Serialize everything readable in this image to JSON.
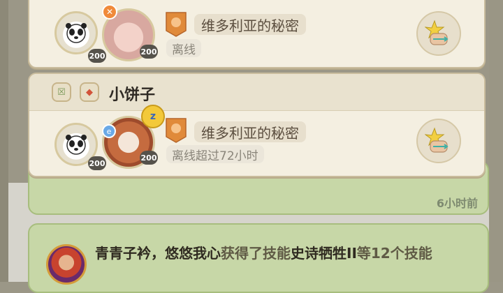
{
  "friends": [
    {
      "name": "",
      "avatars": [
        {
          "kind": "panda",
          "level": "200"
        },
        {
          "kind": "pink",
          "level": "200"
        }
      ],
      "zone": "维多利亚的秘密",
      "status": "离线"
    },
    {
      "name": "小饼子",
      "avatars": [
        {
          "kind": "panda",
          "level": "200"
        },
        {
          "kind": "girl",
          "level": "200"
        }
      ],
      "zone": "维多利亚的秘密",
      "status": "离线超过72小时"
    }
  ],
  "feed": {
    "prev_time": "6小时前",
    "current": {
      "player": "青青子衿，悠悠我心",
      "verb": "获得了技能",
      "skill": "史诗牺牲II",
      "rest": "等12个技能"
    }
  },
  "colors": {
    "card_bg": "#f4efe1",
    "feed_bg": "#c7d7a7",
    "badge_orange": "#e08a3a"
  }
}
